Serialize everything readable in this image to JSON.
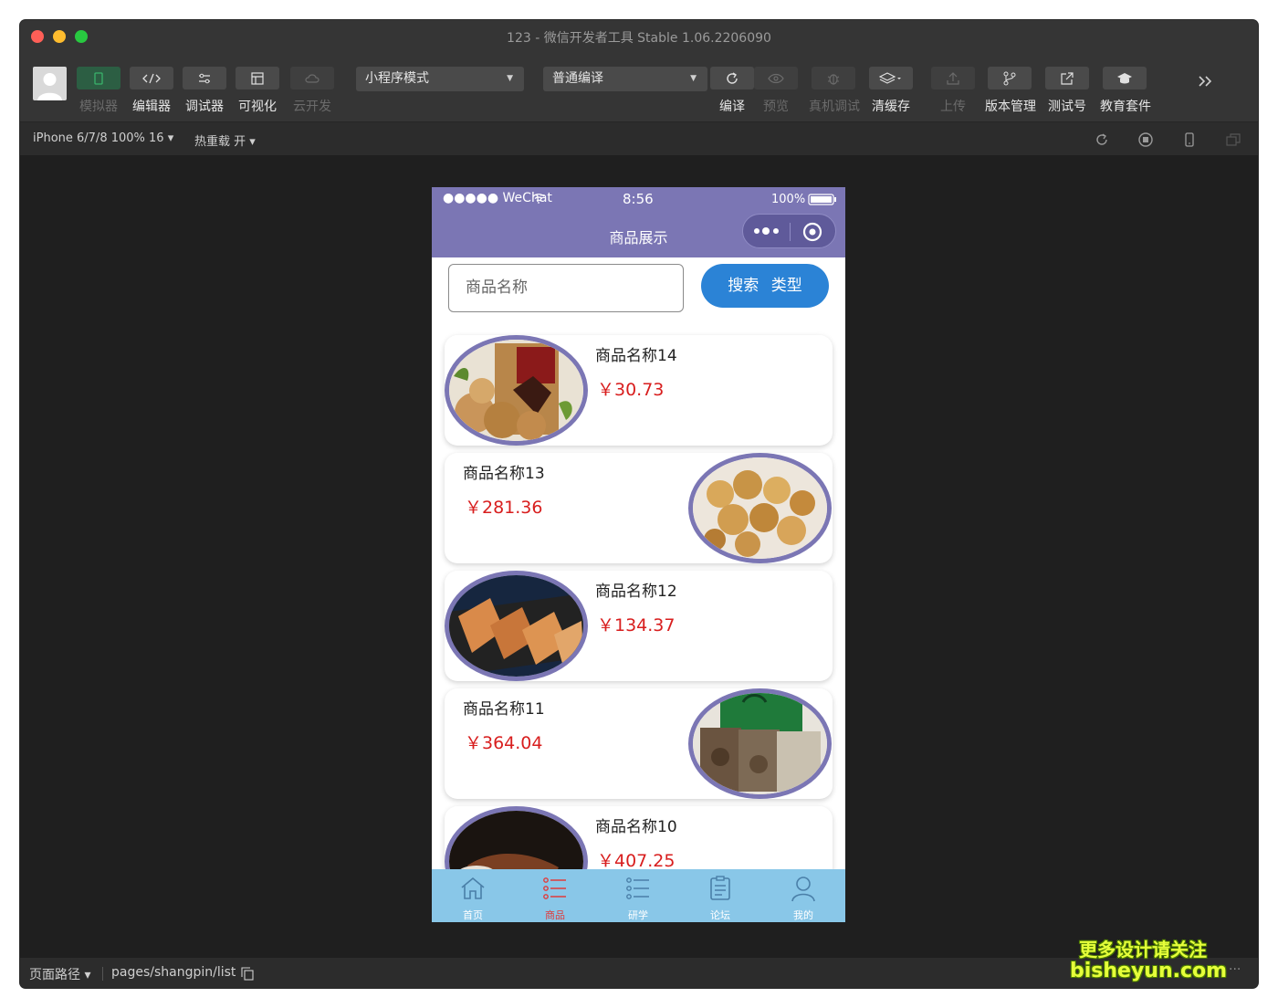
{
  "window": {
    "title": "123 - 微信开发者工具 Stable 1.06.2206090"
  },
  "toolbar": {
    "simulator": "模拟器",
    "editor": "编辑器",
    "debugger": "调试器",
    "visual": "可视化",
    "cloud": "云开发",
    "mode_select": "小程序模式",
    "compile_select": "普通编译",
    "compile": "编译",
    "preview": "预览",
    "remote_debug": "真机调试",
    "clear_cache": "清缓存",
    "upload": "上传",
    "version": "版本管理",
    "test_account": "测试号",
    "edu": "教育套件"
  },
  "subbar": {
    "device": "iPhone 6/7/8 100% 16 ▾",
    "hot_reload": "热重载 开 ▾"
  },
  "phone": {
    "status_left": "●●●●● WeChat",
    "status_time": "8:56",
    "status_battery": "100%",
    "nav_title": "商品展示",
    "search_placeholder": "商品名称",
    "search_button": "搜索 类型",
    "products": [
      {
        "name": "商品名称14",
        "price": "￥30.73"
      },
      {
        "name": "商品名称13",
        "price": "￥281.36"
      },
      {
        "name": "商品名称12",
        "price": "￥134.37"
      },
      {
        "name": "商品名称11",
        "price": "￥364.04"
      },
      {
        "name": "商品名称10",
        "price": "￥407.25"
      }
    ],
    "tabs": [
      "首页",
      "商品",
      "研学",
      "论坛",
      "我的"
    ]
  },
  "bottombar": {
    "path_label": "页面路径 ▾",
    "path": "pages/shangpin/list",
    "more": "···"
  },
  "watermark": {
    "line1": "更多设计请关注",
    "line2": "bisheyun.com"
  },
  "colors": {
    "nav": "#7b76b4",
    "tabbar": "#89c7e8",
    "price": "#d81e1e",
    "search_button": "#2b83d6"
  }
}
